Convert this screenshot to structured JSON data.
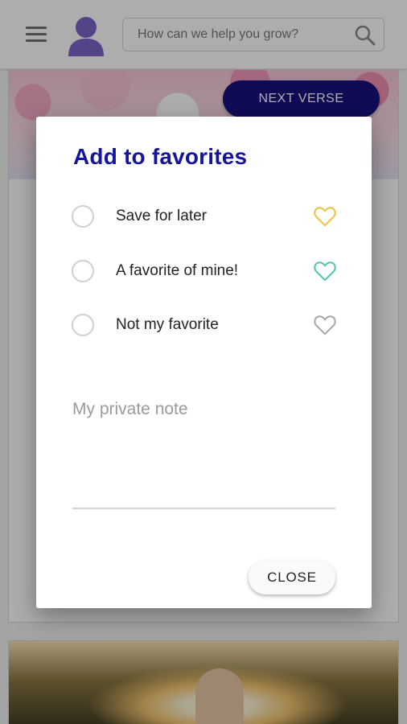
{
  "header": {
    "search_placeholder": "How can we help you grow?",
    "next_button_label": "NEXT VERSE"
  },
  "dialog": {
    "title": "Add to favorites",
    "options": [
      {
        "label": "Save for later",
        "heart_color": "#f0c23c"
      },
      {
        "label": "A favorite of mine!",
        "heart_color": "#4fc7a8"
      },
      {
        "label": "Not my favorite",
        "heart_color": "#a8a8a8"
      }
    ],
    "note_placeholder": "My private note",
    "close_label": "CLOSE"
  },
  "colors": {
    "brand": "#17117e",
    "title": "#1414a0",
    "avatar": "#7c64c8"
  },
  "icons": {
    "menu": "menu-icon",
    "avatar": "user-icon",
    "search": "search-icon",
    "heart": "heart-outline-icon"
  }
}
